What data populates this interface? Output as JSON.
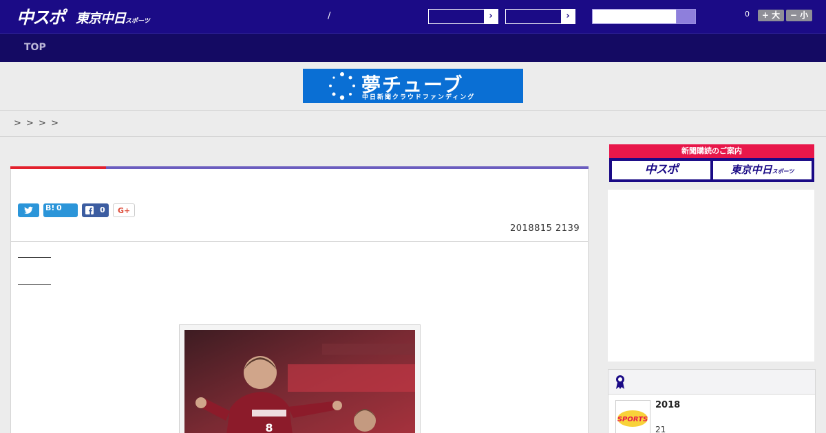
{
  "header": {
    "logo_chuspo": "中スポ",
    "logo_tokyo": "東京中日",
    "logo_tokyo_small": "スポーツ",
    "slash": "/",
    "font_count": "0",
    "font_larger": "+ 大",
    "font_smaller": "− 小"
  },
  "nav": {
    "top": "TOP"
  },
  "banner": {
    "title": "夢チューブ",
    "subtitle": "中日新聞クラウドファンディング"
  },
  "breadcrumb": "> > >  >",
  "article": {
    "hatena_label": "B!",
    "hatena_count": "0",
    "facebook_count": "0",
    "gplus_label": "G+",
    "timestamp": "2018815 2139"
  },
  "sidebar": {
    "subscribe_head": "新聞購読のご案内",
    "subscribe_chuspo": "中スポ",
    "subscribe_tokyo": "東京中日",
    "subscribe_tokyo_small": "スポーツ",
    "ranking_item_title": "2018",
    "ranking_item_sub": "21"
  },
  "colors": {
    "header_bg": "#1b0b86",
    "nav_bg": "#140a63",
    "accent_red": "#e3202d",
    "accent_purple": "#6b5dbf",
    "banner_blue": "#0a6fd4",
    "subscribe_pink": "#e8174a"
  },
  "icons": [
    "twitter-icon",
    "hatena-bookmark-icon",
    "facebook-icon",
    "google-plus-icon",
    "ranking-medal-icon",
    "search-icon",
    "chevron-right-icon"
  ]
}
